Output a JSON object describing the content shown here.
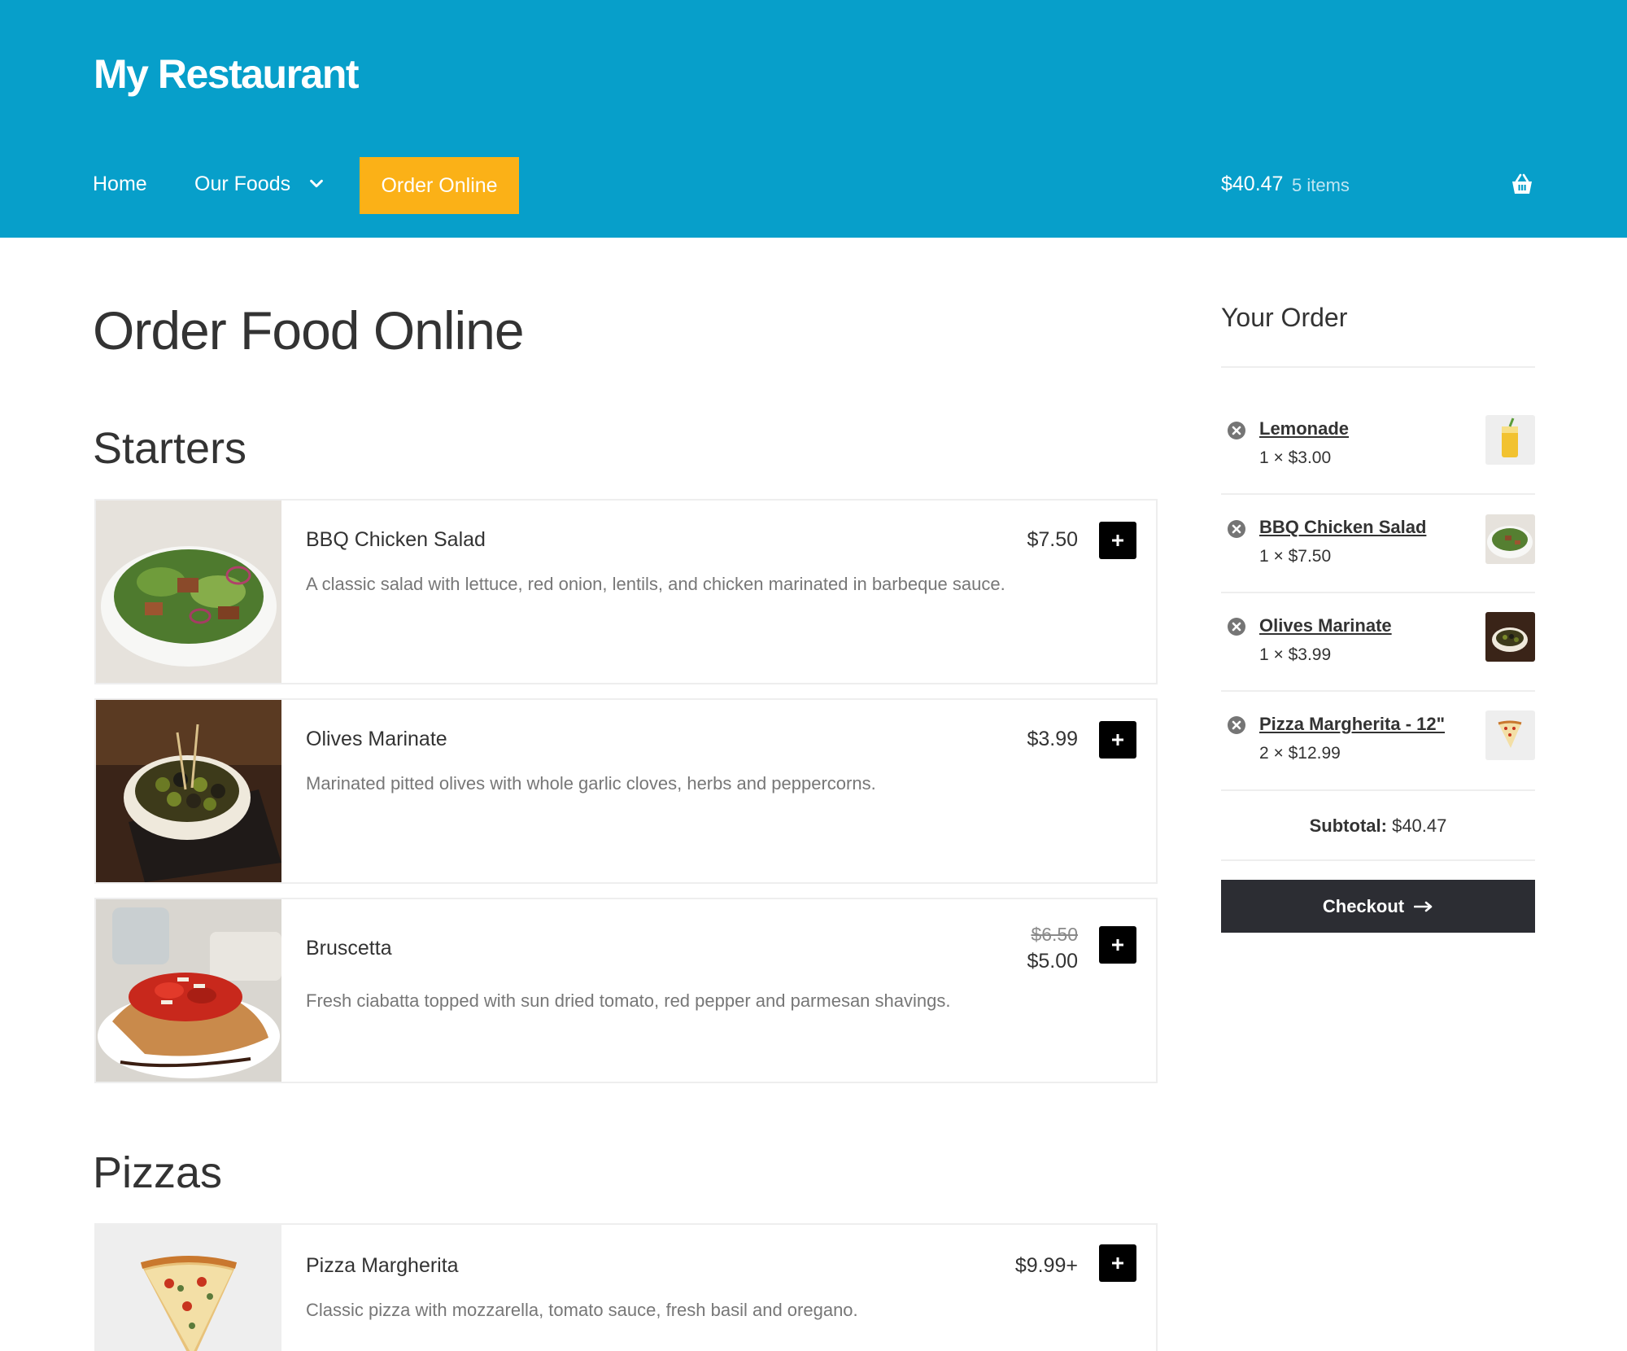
{
  "header": {
    "site_title": "My Restaurant",
    "nav": {
      "home": "Home",
      "our_foods": "Our Foods",
      "order_online": "Order Online"
    },
    "cart": {
      "total": "$40.47",
      "count": "5 items"
    },
    "colors": {
      "header_bg": "#079fca",
      "order_button": "#fbb117"
    }
  },
  "main": {
    "page_title": "Order Food Online",
    "sections": [
      {
        "title": "Starters",
        "items": [
          {
            "name": "BBQ Chicken Salad",
            "desc": "A classic salad with lettuce, red onion, lentils, and chicken marinated in barbeque sauce.",
            "price": "$7.50"
          },
          {
            "name": "Olives Marinate",
            "desc": "Marinated pitted olives with whole garlic cloves, herbs and peppercorns.",
            "price": "$3.99"
          },
          {
            "name": "Bruscetta",
            "desc": "Fresh ciabatta topped with sun dried tomato, red pepper and parmesan shavings.",
            "old_price": "$6.50",
            "price": "$5.00"
          }
        ]
      },
      {
        "title": "Pizzas",
        "items": [
          {
            "name": "Pizza Margherita",
            "desc": "Classic pizza with mozzarella, tomato sauce, fresh basil and oregano.",
            "price": "$9.99+"
          }
        ]
      }
    ]
  },
  "sidebar": {
    "title": "Your Order",
    "items": [
      {
        "name": "Lemonade",
        "qty": "1 × $3.00"
      },
      {
        "name": "BBQ Chicken Salad",
        "qty": "1 × $7.50"
      },
      {
        "name": "Olives Marinate",
        "qty": "1 × $3.99"
      },
      {
        "name": "Pizza Margherita - 12\"",
        "qty": "2 × $12.99"
      }
    ],
    "subtotal_label": "Subtotal:",
    "subtotal_value": "$40.47",
    "checkout_label": "Checkout"
  }
}
